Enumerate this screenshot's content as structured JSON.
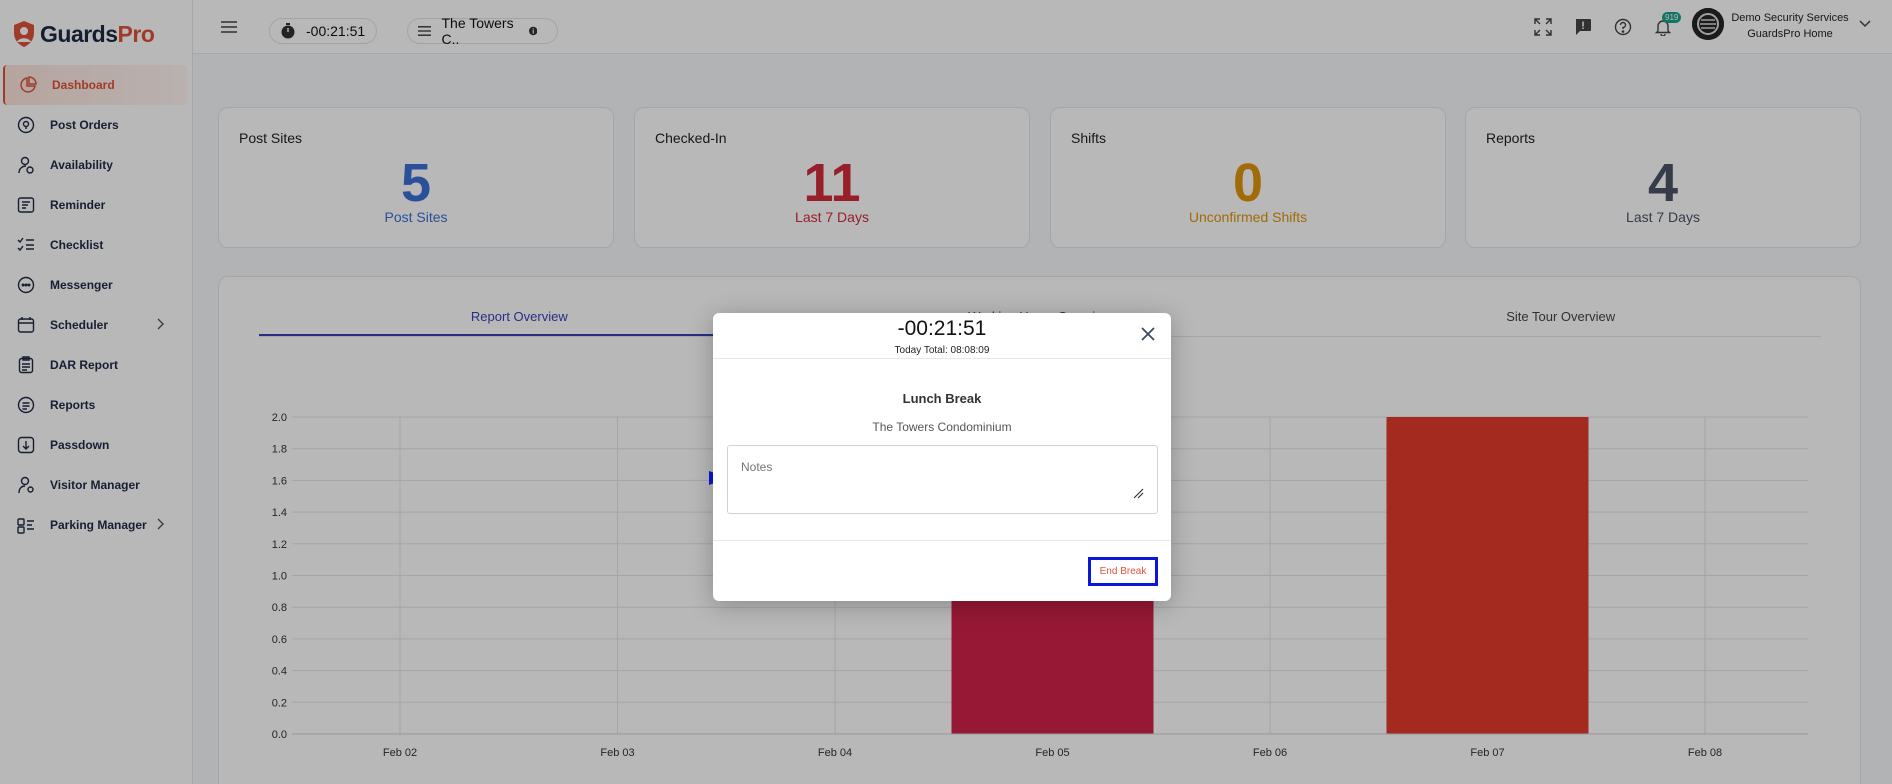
{
  "app": {
    "name_part1": "Guards",
    "name_part2": "Pro",
    "brand_color": "#e0533a",
    "navy": "#1d2a44"
  },
  "sidebar": {
    "items": [
      {
        "label": "Dashboard",
        "icon": "pie-chart-icon",
        "active": true
      },
      {
        "label": "Post Orders",
        "icon": "location-pin-icon"
      },
      {
        "label": "Availability",
        "icon": "user-clock-icon"
      },
      {
        "label": "Reminder",
        "icon": "reminder-icon"
      },
      {
        "label": "Checklist",
        "icon": "checklist-icon"
      },
      {
        "label": "Messenger",
        "icon": "chat-bubble-icon"
      },
      {
        "label": "Scheduler",
        "icon": "calendar-icon",
        "has_submenu": true
      },
      {
        "label": "DAR Report",
        "icon": "clipboard-icon"
      },
      {
        "label": "Reports",
        "icon": "document-icon"
      },
      {
        "label": "Passdown",
        "icon": "passdown-icon"
      },
      {
        "label": "Visitor Manager",
        "icon": "visitor-icon"
      },
      {
        "label": "Parking Manager",
        "icon": "parking-icon",
        "has_submenu": true
      }
    ]
  },
  "header": {
    "timer": "-00:21:51",
    "site": "The Towers C..",
    "notification_count": "919",
    "org_name": "Demo Security Services",
    "org_sub": "GuardsPro Home"
  },
  "cards": [
    {
      "title": "Post Sites",
      "value": "5",
      "sub": "Post Sites",
      "color": "#3b6fd4"
    },
    {
      "title": "Checked-In",
      "value": "11",
      "sub": "Last 7 Days",
      "color": "#d12b3a"
    },
    {
      "title": "Shifts",
      "value": "0",
      "sub": "Unconfirmed Shifts",
      "color": "#e0950a"
    },
    {
      "title": "Reports",
      "value": "4",
      "sub": "Last 7 Days",
      "color": "#4a5364"
    }
  ],
  "tabs": [
    "Report Overview",
    "Working Hours Overview",
    "Site Tour Overview"
  ],
  "chart_data": {
    "type": "bar",
    "categories": [
      "Feb 02",
      "Feb 03",
      "Feb 04",
      "Feb 05",
      "Feb 06",
      "Feb 07",
      "Feb 08"
    ],
    "values": [
      0,
      0,
      0,
      1,
      0,
      2,
      0
    ],
    "colors": [
      "#d1224a",
      "#d1224a",
      "#d1224a",
      "#d1224a",
      "#d1224a",
      "#e43a2c",
      "#d1224a"
    ],
    "ylim": [
      0,
      2.0
    ],
    "yticks": [
      "0.0",
      "0.2",
      "0.4",
      "0.6",
      "0.8",
      "1.0",
      "1.2",
      "1.4",
      "1.6",
      "1.8",
      "2.0"
    ],
    "grid": true
  },
  "modal": {
    "timer": "-00:21:51",
    "today_total": "Today Total: 08:08:09",
    "title": "Lunch Break",
    "site": "The Towers Condominium",
    "notes_placeholder": "Notes",
    "end_button": "End Break"
  }
}
